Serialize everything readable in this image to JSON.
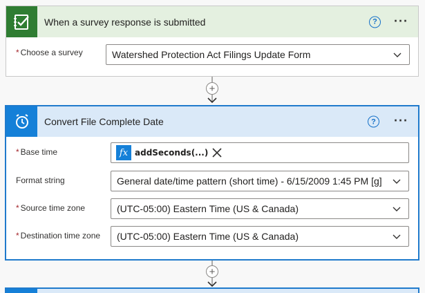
{
  "trigger": {
    "title": "When a survey response is submitted",
    "fields": {
      "survey": {
        "label": "Choose a survey",
        "value": "Watershed Protection Act Filings Update Form",
        "required": true
      }
    },
    "icon": "forms-check-icon",
    "color": "#2f7d32"
  },
  "action": {
    "title": "Convert File Complete Date",
    "icon": "clock-icon",
    "color": "#1580d8",
    "fields": {
      "base_time": {
        "label": "Base time",
        "token_label": "addSeconds(...)",
        "token_fx": "fx",
        "required": true
      },
      "format_string": {
        "label": "Format string",
        "value": "General date/time pattern (short time) - 6/15/2009 1:45 PM [g]",
        "required": false
      },
      "source_tz": {
        "label": "Source time zone",
        "value": "(UTC-05:00) Eastern Time (US & Canada)",
        "required": true
      },
      "dest_tz": {
        "label": "Destination time zone",
        "value": "(UTC-05:00) Eastern Time (US & Canada)",
        "required": true
      }
    }
  },
  "controls": {
    "help": "?",
    "more": "···",
    "add": "+",
    "required_mark": "*"
  }
}
